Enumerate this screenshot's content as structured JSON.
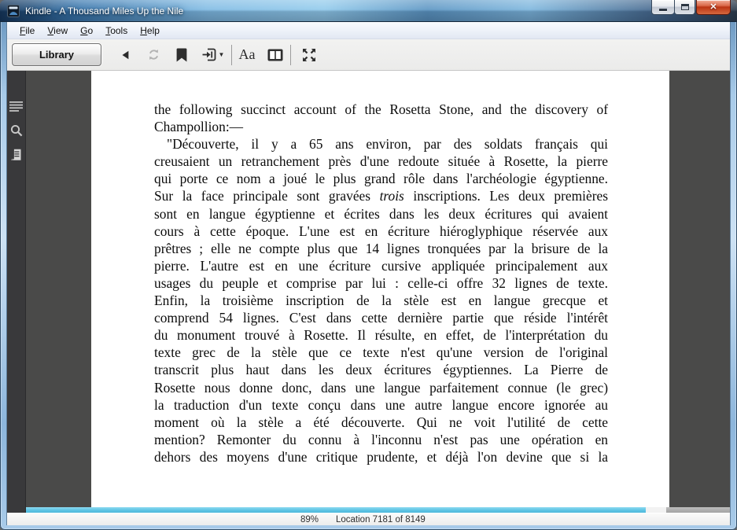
{
  "window": {
    "title": "Kindle - A Thousand Miles Up the Nile",
    "icons": [
      "kindle-app-icon",
      "minimize-icon",
      "maximize-icon",
      "close-icon"
    ]
  },
  "menu": {
    "items": [
      {
        "label": "File"
      },
      {
        "label": "View"
      },
      {
        "label": "Go"
      },
      {
        "label": "Tools"
      },
      {
        "label": "Help"
      }
    ]
  },
  "toolbar": {
    "library_label": "Library",
    "text_size_label": "Aa",
    "icons": [
      "back-icon",
      "sync-icon",
      "bookmark-icon",
      "goto-icon",
      "text-size-icon",
      "columns-icon",
      "fullscreen-icon"
    ]
  },
  "sidebar": {
    "icons": [
      "toc-icon",
      "search-icon",
      "notes-icon"
    ]
  },
  "book": {
    "page_lines": [
      {
        "t": "the following succinct account of the Rosetta Stone, and the discovery of"
      },
      {
        "t": "Champollion:—",
        "j": false
      },
      {
        "t": "\"Découverte, il y a 65 ans environ, par des soldats français qui",
        "in": true
      },
      {
        "t": "creusaient un retranchement près d'une redoute située à Rosette, la pierre"
      },
      {
        "t": "qui porte ce nom a joué le plus grand rôle dans l'archéologie égyptienne."
      },
      {
        "t": "Sur la face principale sont gravées *trois* inscriptions. Les deux premières"
      },
      {
        "t": "sont en langue égyptienne et écrites dans les deux écritures qui avaient"
      },
      {
        "t": "cours à cette époque. L'une est en écriture hiéroglyphique réservée aux"
      },
      {
        "t": "prêtres ; elle ne compte plus que 14 lignes tronquées par la brisure de la"
      },
      {
        "t": "pierre. L'autre est en une écriture cursive appliquée principalement aux"
      },
      {
        "t": "usages du peuple et comprise par lui : celle-ci offre 32 lignes de texte."
      },
      {
        "t": "Enfin, la troisième inscription de la stèle est en langue grecque et"
      },
      {
        "t": "comprend 54 lignes. C'est dans cette dernière partie que réside l'intérêt"
      },
      {
        "t": "du monument trouvé à Rosette. Il résulte, en effet, de l'interprétation du"
      },
      {
        "t": "texte grec de la stèle que ce texte n'est qu'une version de l'original"
      },
      {
        "t": "transcrit plus haut dans les deux écritures égyptiennes. La Pierre de"
      },
      {
        "t": "Rosette nous donne donc, dans une langue parfaitement connue (le grec)"
      },
      {
        "t": "la traduction d'un texte conçu dans une autre langue encore ignorée au"
      },
      {
        "t": "moment où la stèle a été découverte. Qui ne voit l'utilité de cette"
      },
      {
        "t": "mention? Remonter du connu à l'inconnu n'est pas une opération en"
      },
      {
        "t": "dehors des moyens d'une critique prudente, et déjà l'on devine que si la"
      }
    ]
  },
  "progress": {
    "fill_percent": 88.1,
    "fill_color": "#5ec4e4"
  },
  "statusbar": {
    "percent": "89%",
    "location": "Location 7181 of 8149"
  }
}
